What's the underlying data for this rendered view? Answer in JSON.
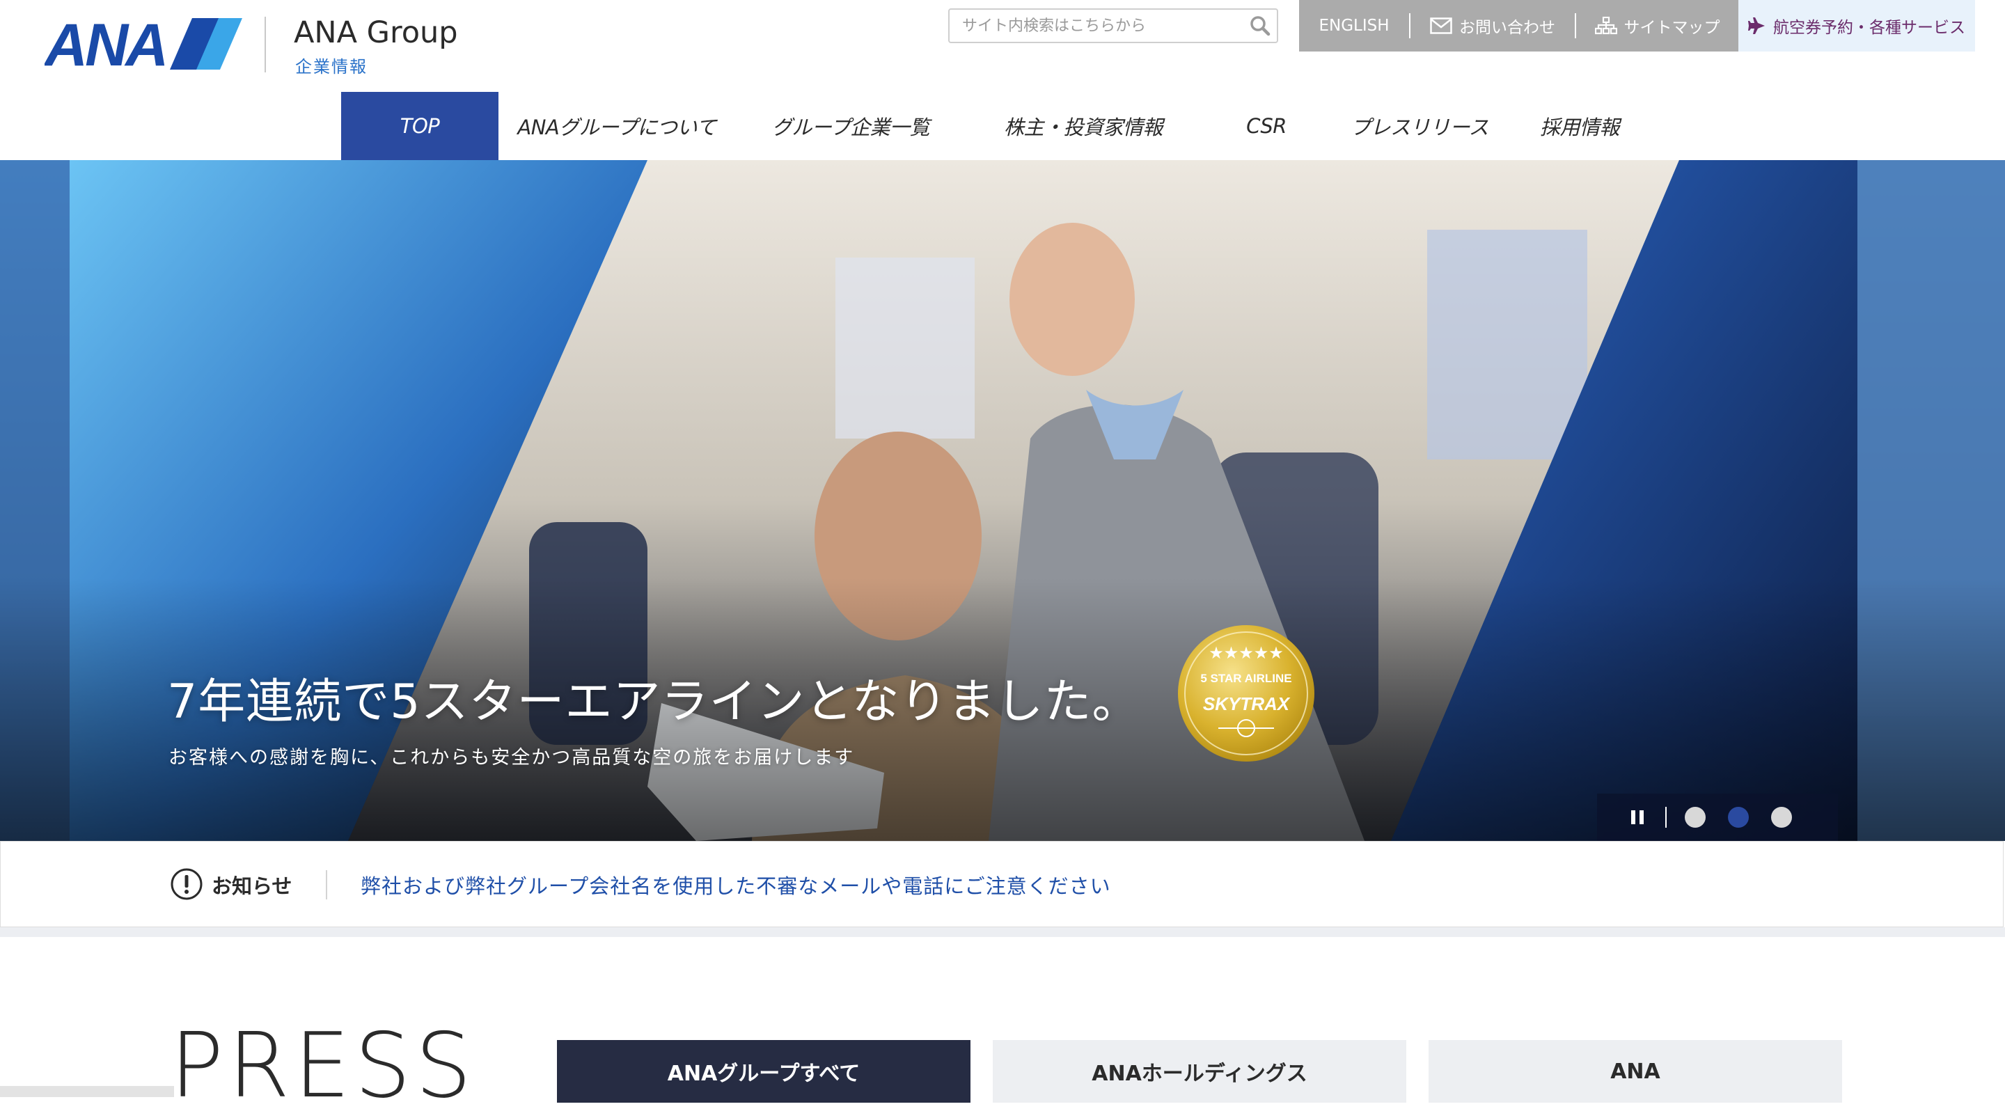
{
  "header": {
    "logo_text": "ANA",
    "group_title": "ANA Group",
    "group_subtitle": "企業情報",
    "search": {
      "placeholder": "サイト内検索はこちらから",
      "value": ""
    },
    "util_links": [
      {
        "label": "ENGLISH",
        "icon": ""
      },
      {
        "label": "お問い合わせ",
        "icon": "mail-icon"
      },
      {
        "label": "サイトマップ",
        "icon": "sitemap-icon"
      }
    ],
    "booking": {
      "label": "航空券予約・各種サービス",
      "icon": "airplane-icon"
    }
  },
  "nav": {
    "tabs": [
      {
        "label": "TOP",
        "active": true
      },
      {
        "label": "ANAグループについて",
        "active": false
      },
      {
        "label": "グループ企業一覧",
        "active": false
      },
      {
        "label": "株主・投資家情報",
        "active": false
      },
      {
        "label": "CSR",
        "active": false
      },
      {
        "label": "プレスリリース",
        "active": false
      },
      {
        "label": "採用情報",
        "active": false
      }
    ]
  },
  "hero": {
    "title": "7年連続で5スターエアラインとなりました。",
    "subtitle": "お客様への感謝を胸に、これからも安全かつ高品質な空の旅をお届けします",
    "badge": {
      "top_text": "5 STAR AIRLINE",
      "brand": "SKYTRAX"
    },
    "slider": {
      "paused": false,
      "slide_count": 3,
      "active_index": 1
    }
  },
  "notice": {
    "label": "お知らせ",
    "message": "弊社および弊社グループ会社名を使用した不審なメールや電話にご注意ください"
  },
  "press": {
    "heading": "PRESS",
    "tabs": [
      {
        "label": "ANAグループすべて",
        "active": true
      },
      {
        "label": "ANAホールディングス",
        "active": false
      },
      {
        "label": "ANA",
        "active": false
      }
    ]
  },
  "colors": {
    "brand_blue": "#2a4aa0",
    "utility_gray": "#ababab",
    "booking_bg": "#e8f2fb",
    "notice_link": "#1f4fa8",
    "press_tab_active": "#262c43"
  }
}
